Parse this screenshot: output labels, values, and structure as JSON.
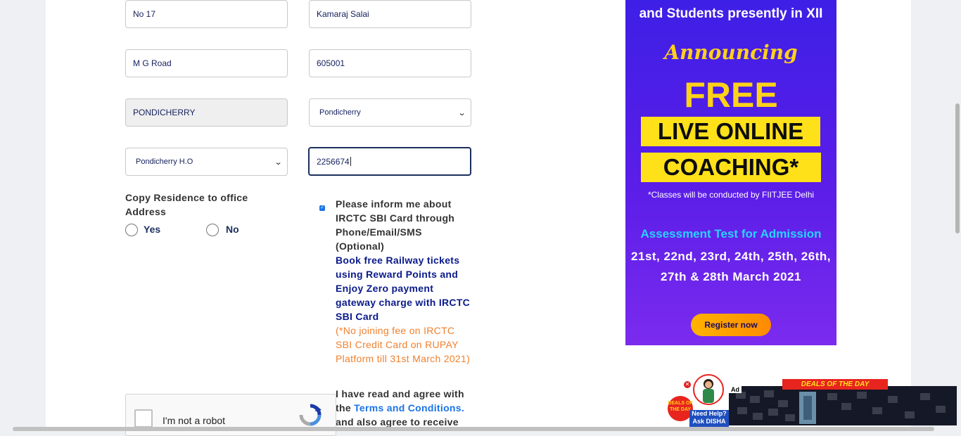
{
  "address": {
    "flat": "No 17",
    "street": "Kamaraj Salai",
    "area": "M G Road",
    "pincode": "605001",
    "city": "PONDICHERRY",
    "state": "Pondicherry",
    "post_office": "Pondicherry H.O",
    "phone": "2256674"
  },
  "copy_residence": {
    "label": "Copy Residence to office Address",
    "yes": "Yes",
    "no": "No"
  },
  "consent": {
    "inform": "Please inform me about IRCTC SBI Card through Phone/Email/SMS (Optional)",
    "promo": "Book free Railway tickets using Reward Points and Enjoy Zero payment gateway charge with IRCTC SBI Card",
    "note": "(*No joining fee on IRCTC SBI Credit Card on RUPAY Platform till 31st March 2021)"
  },
  "terms": {
    "prefix": "I have read and agree with the",
    "link": "Terms and Conditions.",
    "suffix": "and also agree to receive"
  },
  "captcha": {
    "label": "I'm not a robot"
  },
  "banner": {
    "top_line": "and Students presently in XII",
    "announcing": "Announcing",
    "free": "FREE",
    "line1": "LIVE ONLINE",
    "line2": "COACHING*",
    "note": "*Classes will be conducted by FIITJEE Delhi",
    "assessment": "Assessment Test for Admission",
    "dates": "21st, 22nd, 23rd, 24th, 25th, 26th, 27th & 28th March 2021",
    "button": "Register now"
  },
  "disha": {
    "deals_badge": "DEALS OF THE DAY",
    "help": "Need Help? Ask DISHA"
  },
  "ad": {
    "tag": "Ad",
    "ribbon": "DEALS OF THE DAY"
  },
  "colors": {
    "accent_blue": "#1a73e8",
    "navy_text": "#0a1a8a",
    "orange_text": "#f0812e",
    "banner_purple": "#4a1fe8",
    "banner_yellow": "#ffe11a"
  }
}
